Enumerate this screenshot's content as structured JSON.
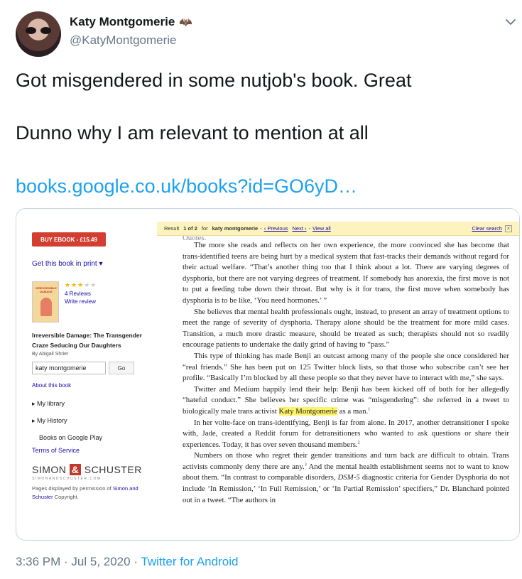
{
  "tweet": {
    "author_name": "Katy Montgomerie",
    "author_handle": "@KatyMontgomerie",
    "line1": "Got misgendered in some nutjob's book. Great",
    "line2": "Dunno why I am relevant to mention at all",
    "link": "books.google.co.uk/books?id=GO6yD…",
    "time": "3:36 PM",
    "date": "Jul 5, 2020",
    "source": "Twitter for Android"
  },
  "book_panel": {
    "buy_label": "BUY EBOOK - £15.49",
    "get_print": "Get this book in print ▾",
    "rating_filled": "★★★",
    "rating_empty": "★★",
    "reviews": "4 Reviews",
    "write_review": "Write review",
    "cover_text": "IRREVERSIBLE DAMAGE",
    "title": "Irreversible Damage: The Transgender Craze Seducing Our Daughters",
    "author": "By Abigail Shrier",
    "search_value": "katy montgomerie",
    "go_label": "Go",
    "about": "About this book",
    "my_library": "My library",
    "my_history": "My History",
    "google_play": "Books on Google Play",
    "terms": "Terms of Service",
    "publisher_a": "SIMON",
    "publisher_amp": "&",
    "publisher_b": "SCHUSTER",
    "publisher_url": "SIMONANDSCHUSTER.COM",
    "perm_prefix": "Pages displayed by permission of",
    "perm_link": "Simon and Schuster",
    "perm_suffix": "Copyright."
  },
  "result_bar": {
    "result_prefix": "Result",
    "result_num": "1 of 2",
    "result_for": "for",
    "query": "katy montgomerie",
    "prev": "‹ Previous",
    "next": "Next ›",
    "view_all": "View all",
    "clear": "Clear search",
    "close": "×"
  },
  "page_text": {
    "frag": "Quotes.",
    "p1": "The more she reads and reflects on her own experience, the more convinced she has become that trans-identified teens are being hurt by a medical system that fast-tracks their demands without regard for their actual welfare. “That’s another thing too that I think about a lot. There are varying degrees of dysphoria, but there are not varying degrees of treatment. If somebody has anorexia, the first move is not to put a feeding tube down their throat. But why is it for trans, the first move when somebody has dysphoria is to be like, ‘You need hormones.’ ”",
    "p2": "She believes that mental health professionals ought, instead, to present an array of treatment options to meet the range of severity of dysphoria. Therapy alone should be the treatment for more mild cases. Transition, a much more drastic measure, should be treated as such; therapists should not so readily encourage patients to undertake the daily grind of having to “pass.”",
    "p3": "This type of thinking has made Benji an outcast among many of the people she once considered her “real friends.” She has been put on 125 Twitter block lists, so that those who subscribe can’t see her profile. “Basically I’m blocked by all these people so that they never have to interact with me,” she says.",
    "p4a": "Twitter and Medium happily lend their help: Benji has been kicked off of both for her allegedly “hateful conduct.” She believes her specific crime was “misgendering”: she referred in a tweet to biologically male trans activist",
    "p4_hl": "Katy Montgomerie",
    "p4b": "as a man.",
    "p4_note": "1",
    "p5a": "In her volte-face on trans-identifying, Benji is far from alone. In 2017, another detransitioner I spoke with, Jade, created a Reddit forum for detransitioners who wanted to ask questions or share their experiences. Today, it has over seven thousand members.",
    "p5_note": "2",
    "p6a": "Numbers on those who regret their gender transitions and turn back are difficult to obtain. Trans activists commonly deny there are any.",
    "p6_note": "3",
    "p6b": "And the mental health establishment seems not to want to know about them. “In contrast to comparable disorders,",
    "p6_em": "DSM-5",
    "p6c": "diagnostic criteria for Gender Dysphoria do not include ‘In Remission,’ ‘In Full Remission,’ or ‘In Partial Remission’ specifiers,” Dr. Blanchard pointed out in a tweet. “The authors in"
  },
  "colors": {
    "twitter_blue": "#1da1f2",
    "buy_red": "#d23f31",
    "highlight": "#fff36b",
    "result_bar": "#fdf3bf"
  },
  "icons": [
    "chevron-down-icon",
    "bat-icon",
    "close-icon"
  ]
}
